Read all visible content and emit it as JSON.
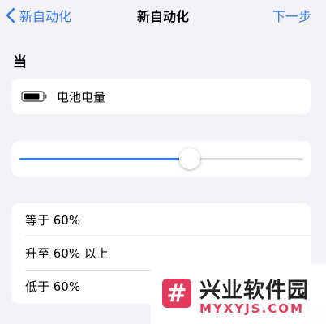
{
  "nav": {
    "back_label": "新自动化",
    "title": "新自动化",
    "next_label": "下一步"
  },
  "trigger": {
    "section_title": "当",
    "battery_label": "电池电量",
    "slider_level_fraction": 0.6
  },
  "options": [
    {
      "label": "等于 60%"
    },
    {
      "label": "升至 60% 以上"
    },
    {
      "label": "低于 60%"
    }
  ],
  "watermark": {
    "symbol": "#",
    "title": "兴业软件园",
    "url": "MYXYJS.COM"
  },
  "colors": {
    "accent": "#3478f6",
    "watermark": "#e33b5c"
  }
}
